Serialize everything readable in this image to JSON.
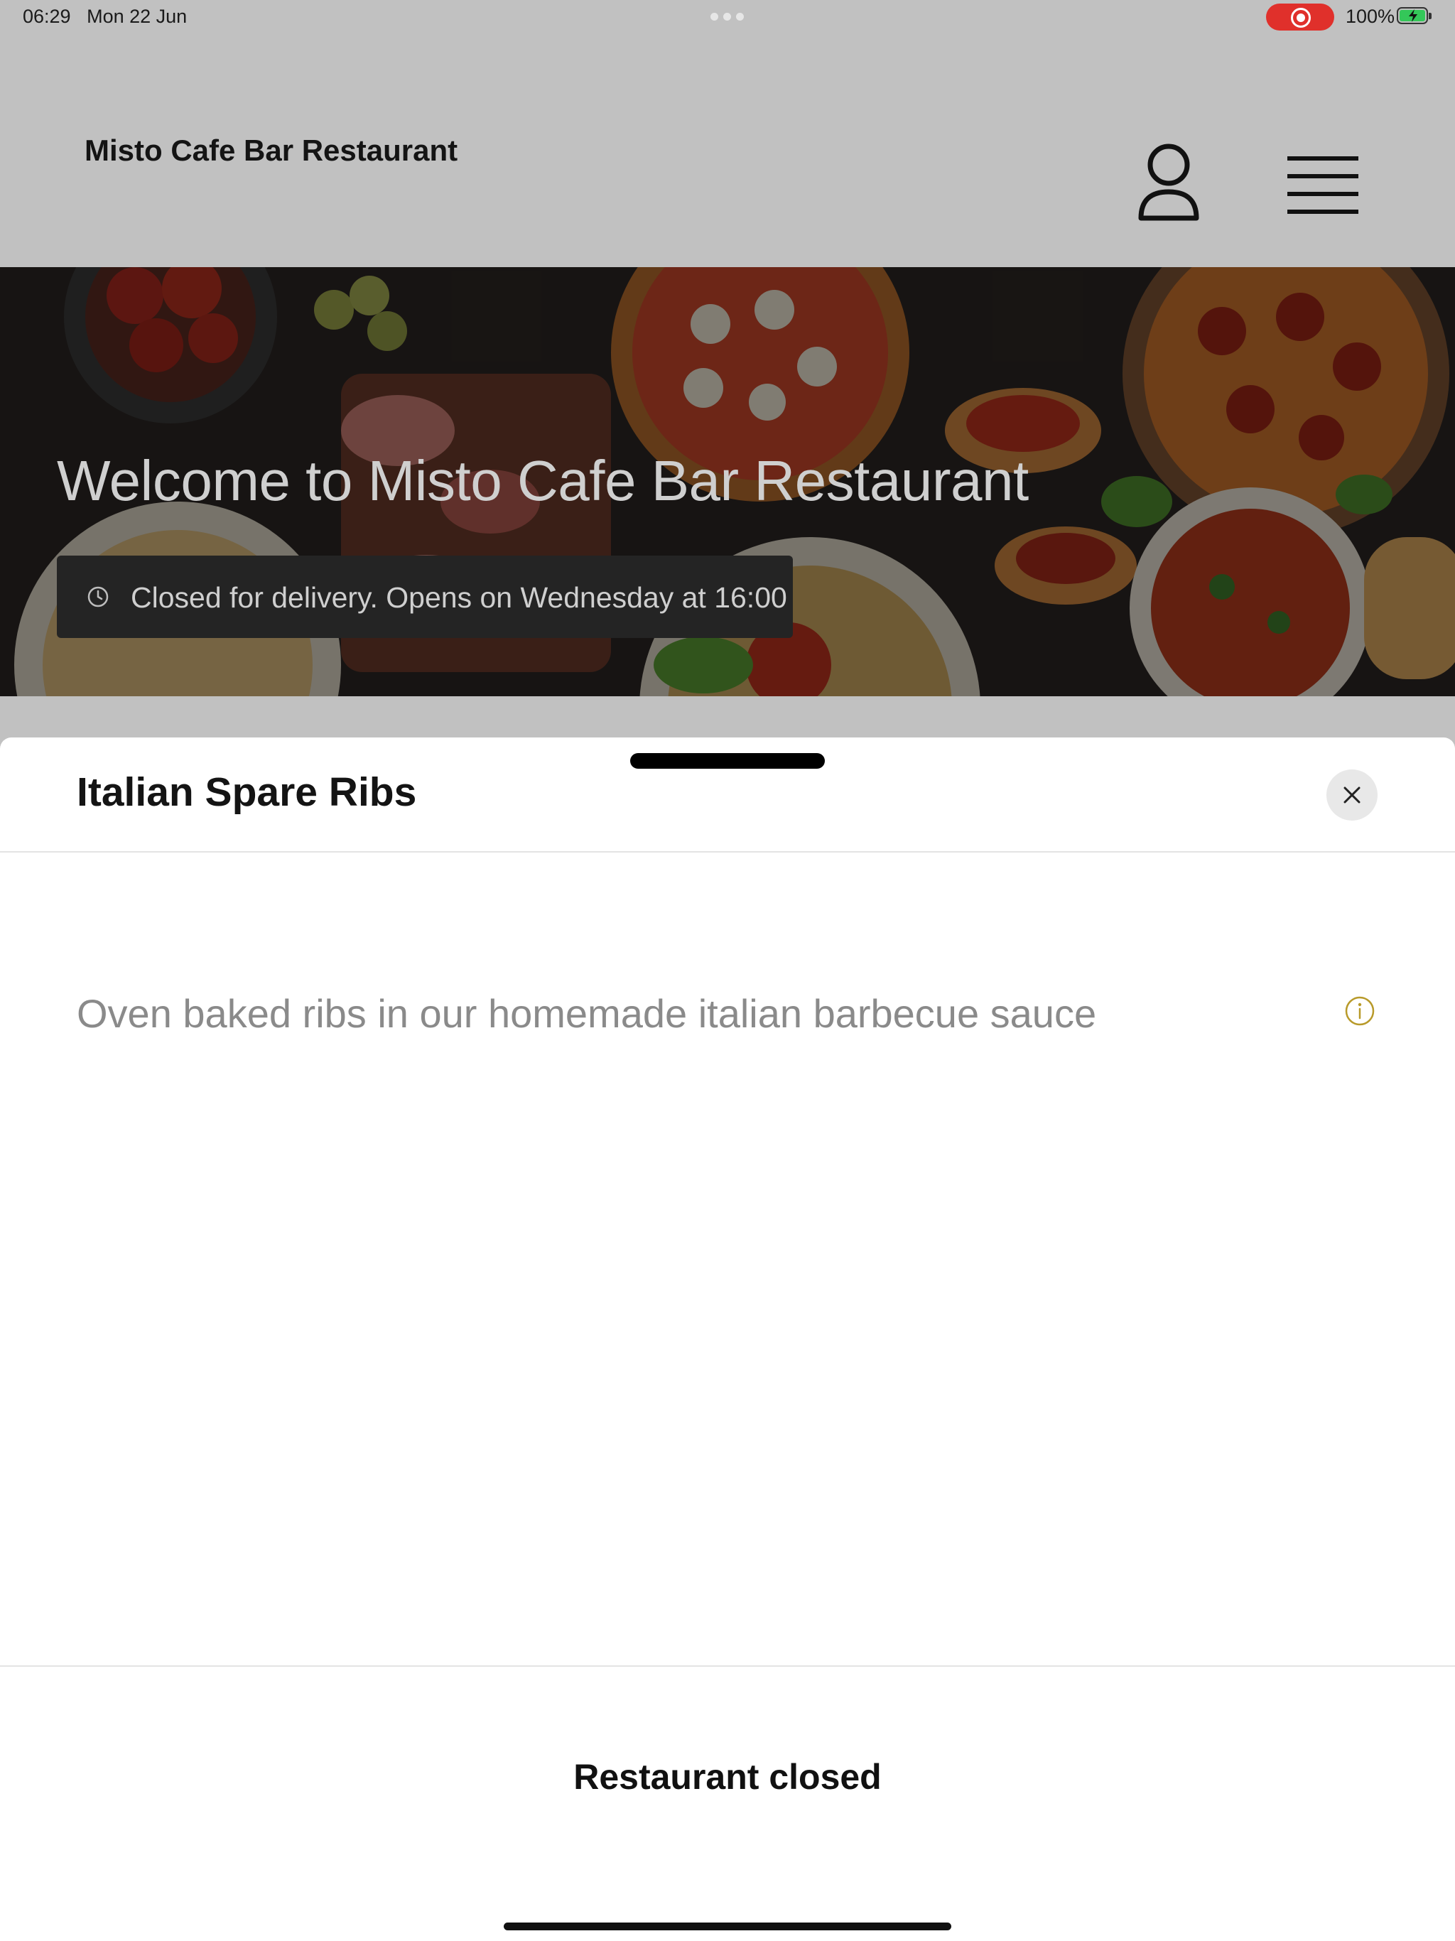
{
  "status_bar": {
    "time": "06:29",
    "date": "Mon 22 Jun",
    "battery_percent": "100%",
    "recording": true,
    "battery_level": 1.0
  },
  "header": {
    "brand": "Misto Cafe Bar Restaurant",
    "icons": [
      "user-icon",
      "menu-icon"
    ]
  },
  "hero": {
    "title": "Welcome to Misto Cafe Bar Restaurant",
    "status_text": "Closed for delivery. Opens on Wednesday at 16:00",
    "status_icon": "clock-icon"
  },
  "sheet": {
    "title": "Italian Spare Ribs",
    "description": "Oven baked ribs in our homemade italian barbecue sauce",
    "info_icon": "info-icon",
    "close_icon": "close-icon",
    "footer_label": "Restaurant closed"
  },
  "colors": {
    "record_red": "#e0302b",
    "battery_green": "#34c759",
    "info_gold": "#b89a2a",
    "overlay_gray": "#c1c1c1"
  }
}
